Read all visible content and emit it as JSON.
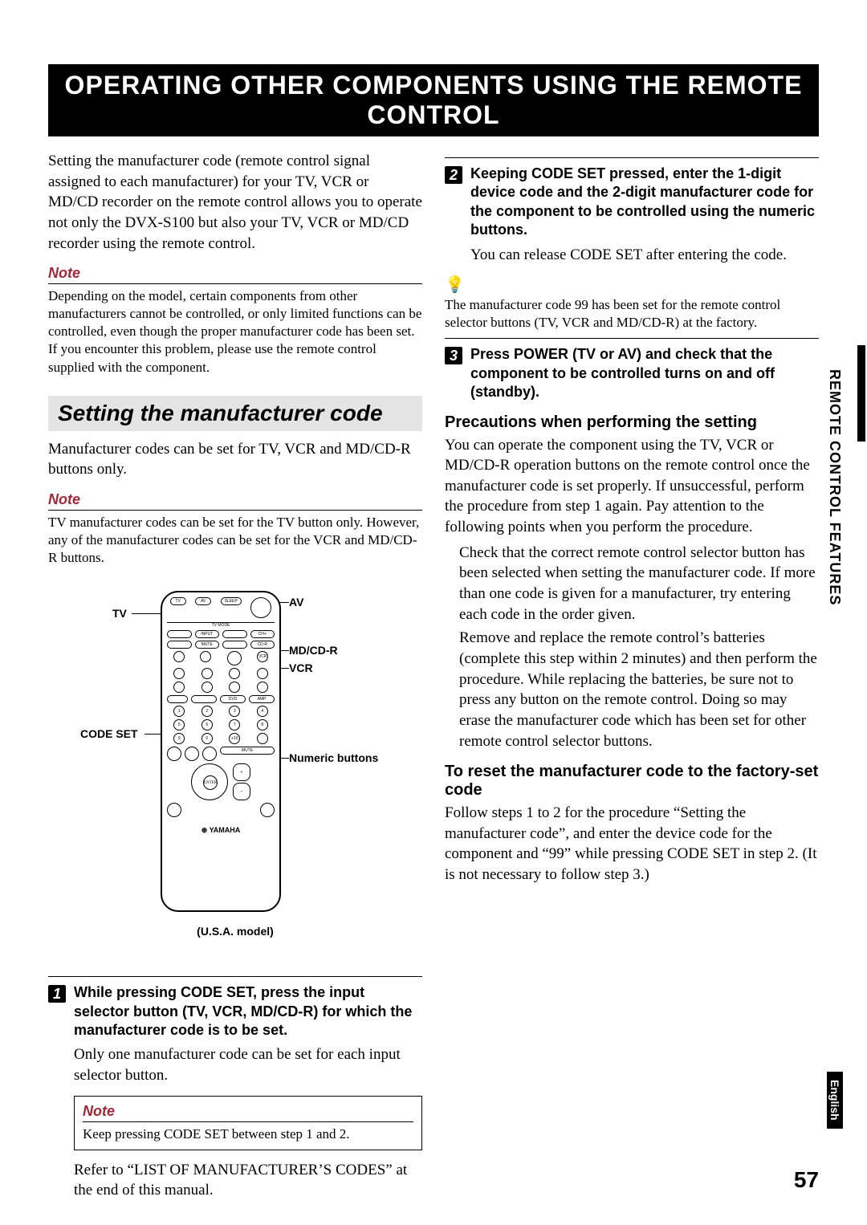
{
  "header": "OPERATING OTHER COMPONENTS USING THE REMOTE CONTROL",
  "intro": "Setting the manufacturer code (remote control signal assigned to each manufacturer) for your TV, VCR or MD/CD recorder on the remote control allows you to operate not only the DVX-S100 but also your TV, VCR or MD/CD recorder using the remote control.",
  "note1_label": "Note",
  "note1_body": "Depending on the model, certain components from other manufacturers cannot be controlled, or only limited functions can be controlled, even though the proper manufacturer code has been set. If you encounter this problem, please use the remote control supplied with the component.",
  "section_heading": "Setting the manufacturer code",
  "section_intro": "Manufacturer codes can be set for TV, VCR and MD/CD-R buttons only.",
  "note2_label": "Note",
  "note2_body": "TV manufacturer codes can be set for the TV button only. However, any of the manufacturer codes can be set for the VCR and MD/CD-R buttons.",
  "remote_labels": {
    "tv": "TV",
    "av": "AV",
    "mdcdr": "MD/CD-R",
    "vcr": "VCR",
    "code_set": "CODE SET",
    "numeric": "Numeric buttons"
  },
  "model_caption": "(U.S.A. model)",
  "logo": "YAMAHA",
  "step1_head": "While pressing CODE SET, press the input selector button (TV, VCR, MD/CD-R) for which the manufacturer code is to be set.",
  "step1_body": "Only one manufacturer code can be set for each input selector button.",
  "boxed_note_label": "Note",
  "boxed_note_body": "Keep pressing CODE SET between step 1 and 2.",
  "refer_line": "Refer to “LIST OF MANUFACTURER’S CODES” at the end of this manual.",
  "step2_head": "Keeping CODE SET pressed, enter the 1-digit device code and the 2-digit manufacturer code for the component to be controlled using the numeric buttons.",
  "step2_body": "You can release CODE SET after entering the code.",
  "tip_body": "The manufacturer code 99 has been set for the remote control selector buttons (TV, VCR and MD/CD-R) at the factory.",
  "step3_head": "Press POWER (TV or AV) and check that the component to be controlled turns on and off (standby).",
  "precautions_head": "Precautions when performing the setting",
  "precautions_body": "You can operate the component using the TV, VCR or MD/CD-R operation buttons on the remote control once the manufacturer code is set properly. If unsuccessful, perform the procedure from step 1 again. Pay attention to the following points when you perform the procedure.",
  "precautions_b1": "Check that the correct remote control selector button has been selected when setting the manufacturer code. If more than one code is given for a manufacturer, try entering each code in the order given.",
  "precautions_b2": "Remove and replace the remote control’s batteries (complete this step within 2 minutes) and then perform the procedure. While replacing the batteries, be sure not to press any button on the remote control. Doing so may erase the manufacturer code which has been set for other remote control selector buttons.",
  "reset_head": "To reset the manufacturer code to the factory-set code",
  "reset_body": "Follow steps 1 to 2 for the procedure “Setting the manufacturer code”, and enter the device code for the component and “99” while pressing CODE SET in step 2. (It is not necessary to follow step 3.)",
  "side_tab": "REMOTE CONTROL FEATURES",
  "side_tab_en": "English",
  "page_number": "57"
}
